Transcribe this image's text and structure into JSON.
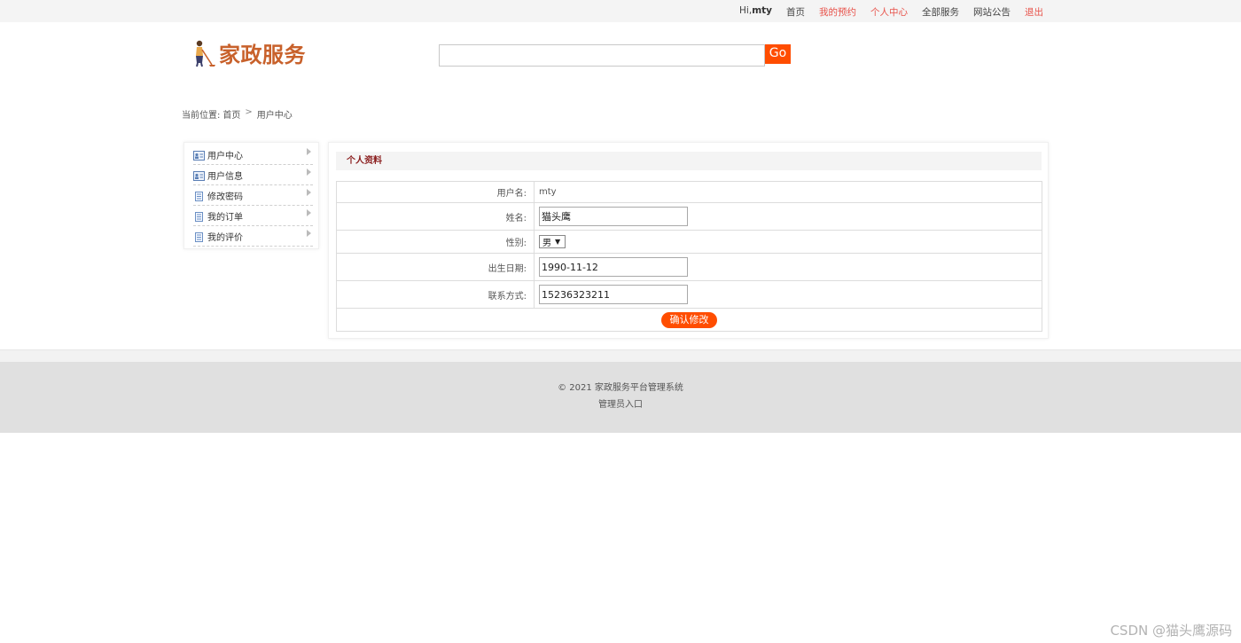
{
  "topnav": {
    "greet_prefix": "Hi,",
    "username": "mty",
    "items": [
      {
        "label": "首页",
        "color": "#444444"
      },
      {
        "label": "我的预约",
        "color": "#e8534b"
      },
      {
        "label": "个人中心",
        "color": "#e8534b"
      },
      {
        "label": "全部服务",
        "color": "#444444"
      },
      {
        "label": "网站公告",
        "color": "#444444"
      },
      {
        "label": "退出",
        "color": "#e8534b"
      }
    ]
  },
  "logo": {
    "text": "家政服务",
    "icon": "cleaner-figure-icon"
  },
  "search": {
    "value": "",
    "button_label": "Go"
  },
  "breadcrumb": {
    "prefix": "当前位置:",
    "home": "首页",
    "separator": ">",
    "current": "用户中心"
  },
  "sidebar": {
    "items": [
      {
        "label": "用户中心",
        "icon": "user-card-icon"
      },
      {
        "label": "用户信息",
        "icon": "user-card-icon"
      },
      {
        "label": "修改密码",
        "icon": "document-icon"
      },
      {
        "label": "我的订单",
        "icon": "document-icon"
      },
      {
        "label": "我的评价",
        "icon": "document-icon"
      }
    ]
  },
  "profile": {
    "title": "个人资料",
    "username_label": "用户名:",
    "username_value": "mty",
    "name_label": "姓名:",
    "name_value": "猫头鹰",
    "gender_label": "性别:",
    "gender_value": "男",
    "birth_label": "出生日期:",
    "birth_value": "1990-11-12",
    "contact_label": "联系方式:",
    "contact_value": "15236323211",
    "submit_label": "确认修改"
  },
  "footer": {
    "copyright": "© 2021 家政服务平台管理系统",
    "admin_link": "管理员入口"
  },
  "watermark": "CSDN @猫头鹰源码",
  "colors": {
    "accent": "#ff4d00",
    "brand": "#c8612b",
    "link_red": "#e8534b",
    "title_red": "#8a1d1d"
  }
}
